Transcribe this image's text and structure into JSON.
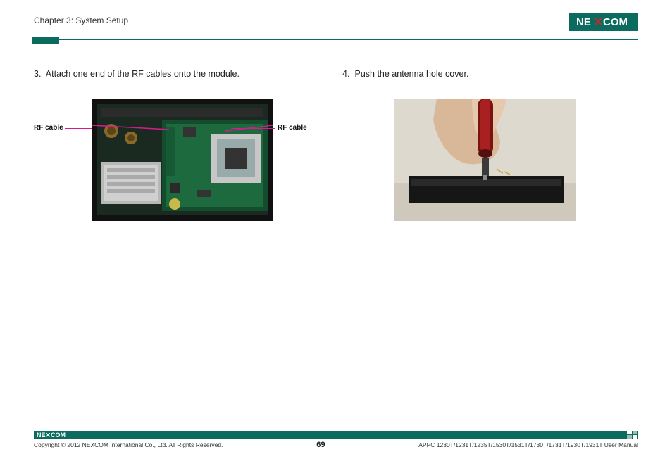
{
  "header": {
    "chapter": "Chapter 3: System Setup",
    "brand": "NEXCOM"
  },
  "steps": {
    "s3": {
      "num": "3.",
      "text": "Attach one end of the RF cables onto the module."
    },
    "s4": {
      "num": "4.",
      "text": "Push the antenna hole cover."
    }
  },
  "labels": {
    "rf_left": "RF cable",
    "rf_right": "RF cable"
  },
  "footer": {
    "copyright": "Copyright © 2012 NEXCOM International Co., Ltd. All Rights Reserved.",
    "page": "69",
    "docref": "APPC 1230T/1231T/1235T/1530T/1531T/1730T/1731T/1930T/1931T User Manual"
  }
}
